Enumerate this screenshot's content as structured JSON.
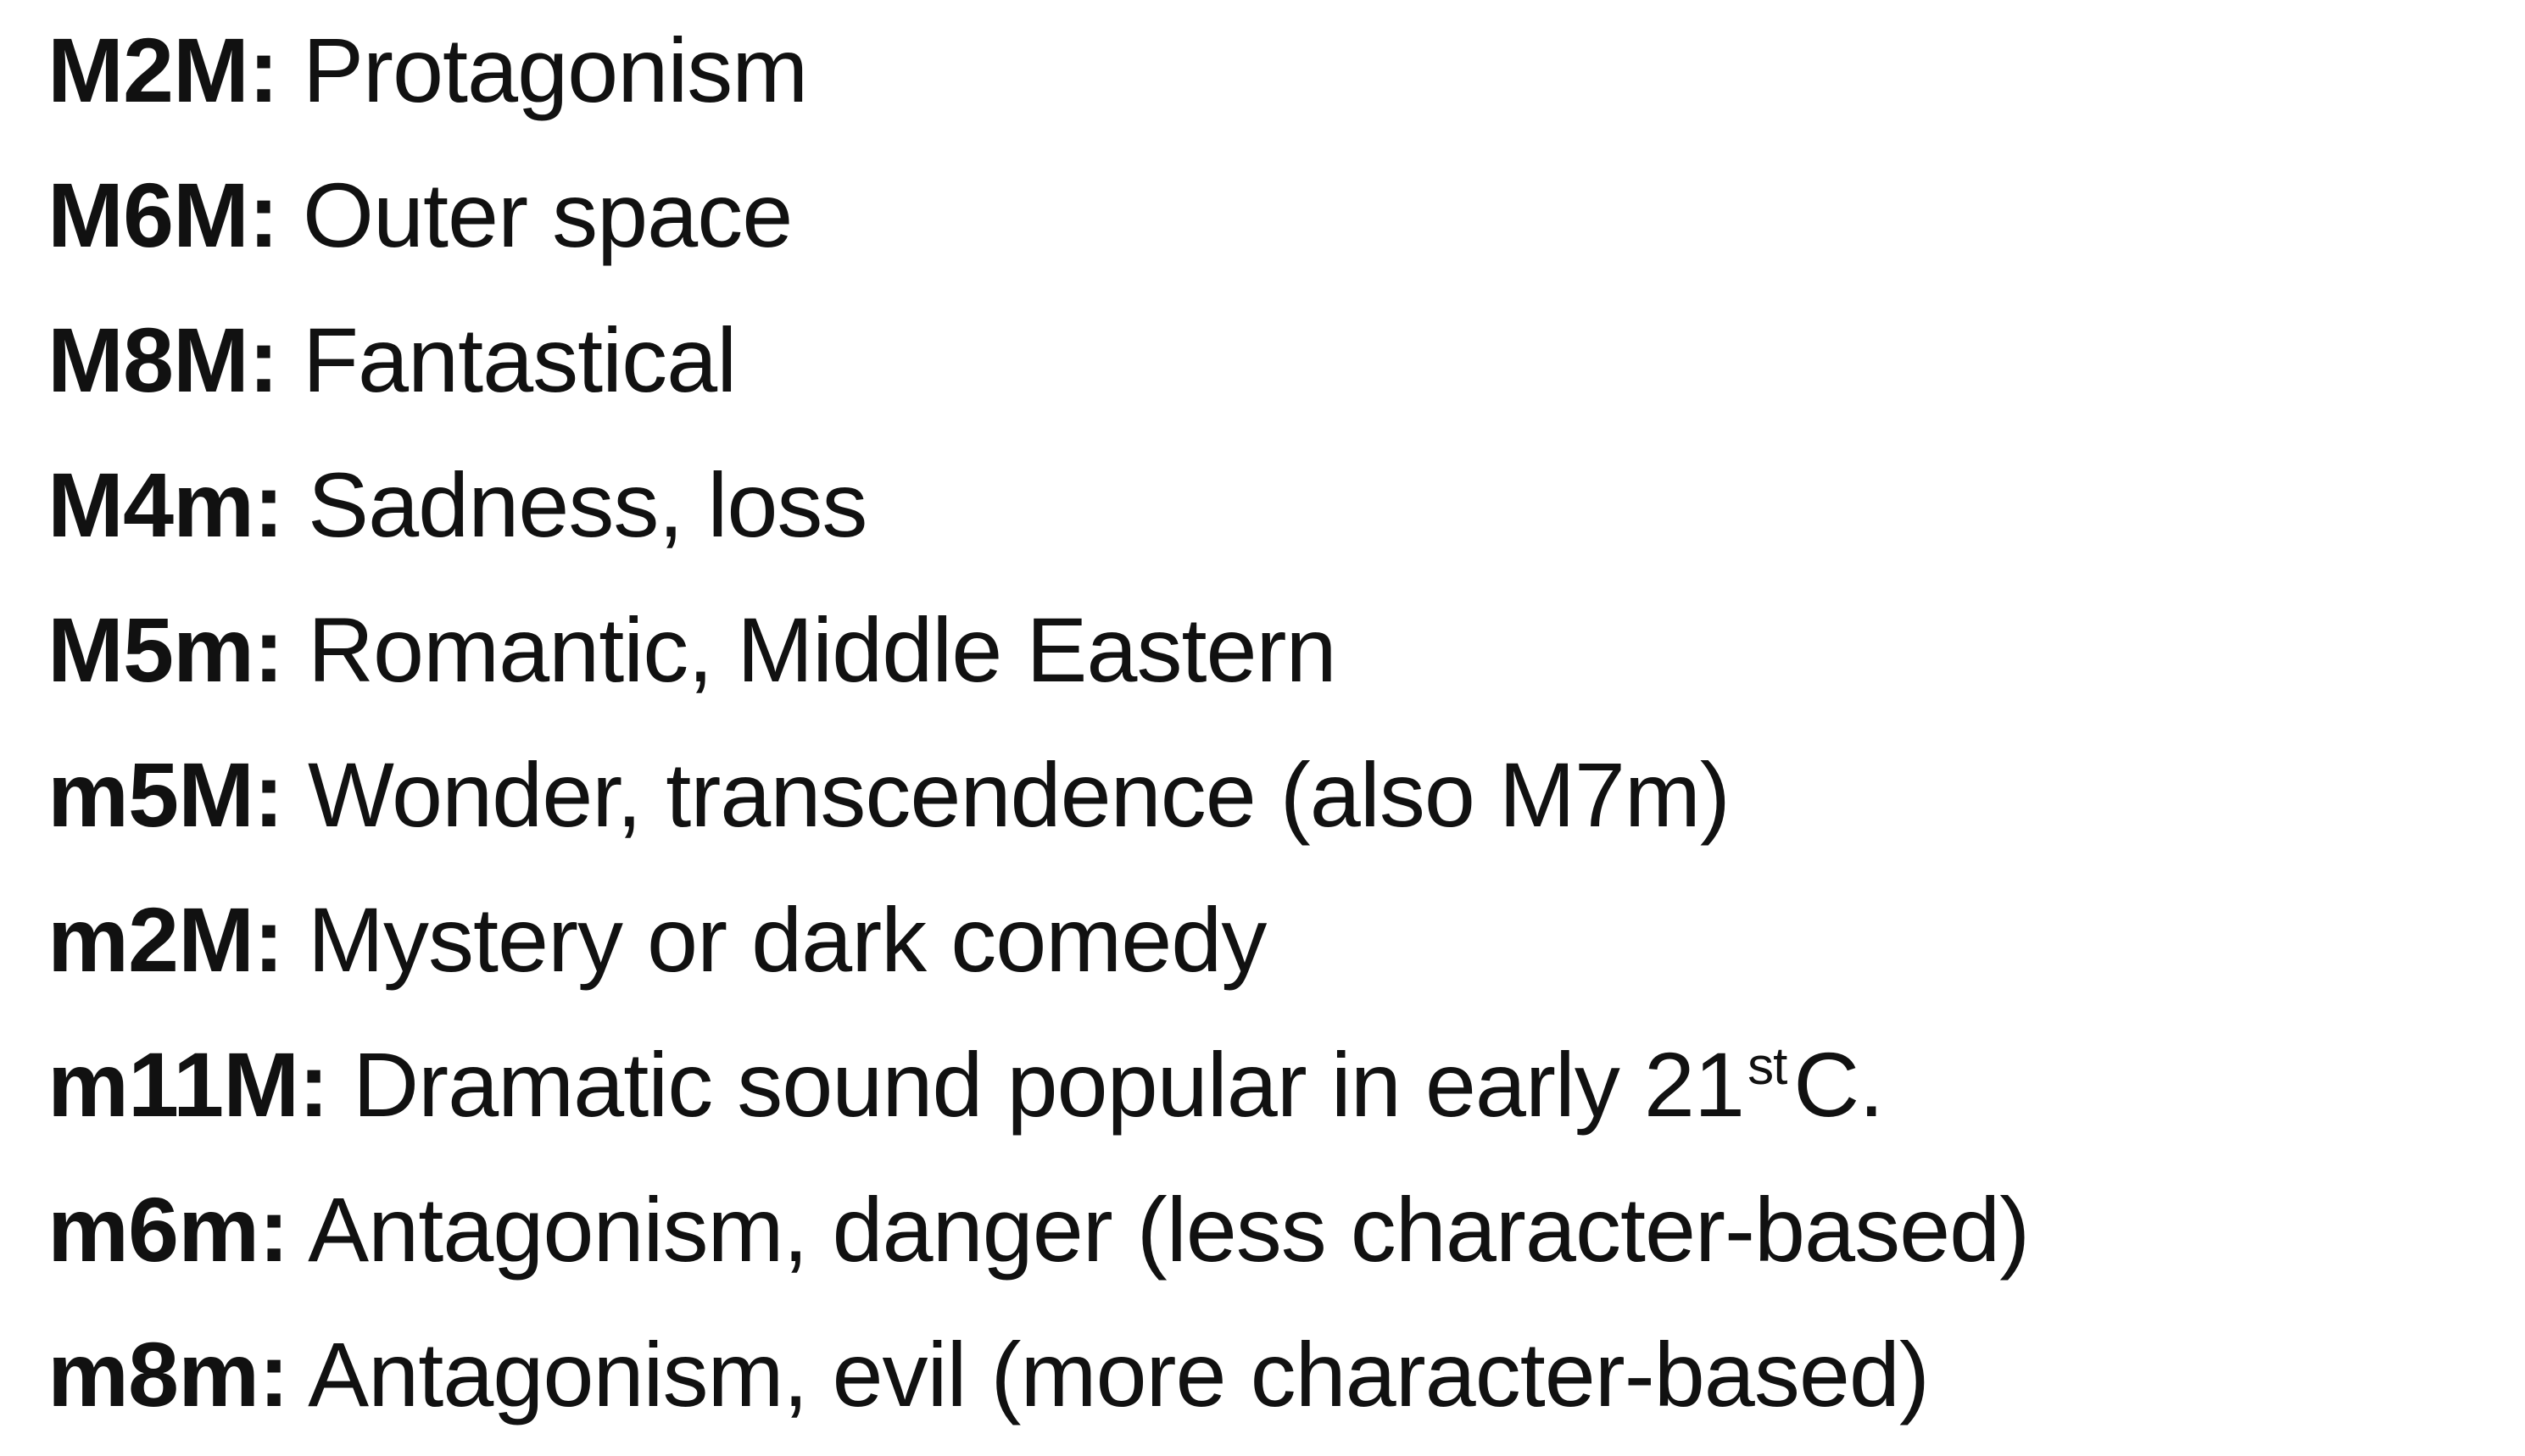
{
  "chords": [
    {
      "code": "M2M:",
      "description": "Protagonism"
    },
    {
      "code": "M6M:",
      "description": "Outer space"
    },
    {
      "code": "M8M:",
      "description": "Fantastical"
    },
    {
      "code": "M4m:",
      "description": "Sadness, loss"
    },
    {
      "code": "M5m:",
      "description": "Romantic, Middle Eastern"
    },
    {
      "code": "m5M:",
      "description": "Wonder, transcendence (also M7m)"
    },
    {
      "code": "m2M:",
      "description": "Mystery or dark comedy"
    },
    {
      "code": "m11M:",
      "description": "Dramatic sound popular in early 21",
      "superscript": "st",
      "suffix": "C."
    },
    {
      "code": "m6m:",
      "description": "Antagonism, danger (less character-based)"
    },
    {
      "code": "m8m:",
      "description": "Antagonism, evil (more character-based)"
    }
  ]
}
